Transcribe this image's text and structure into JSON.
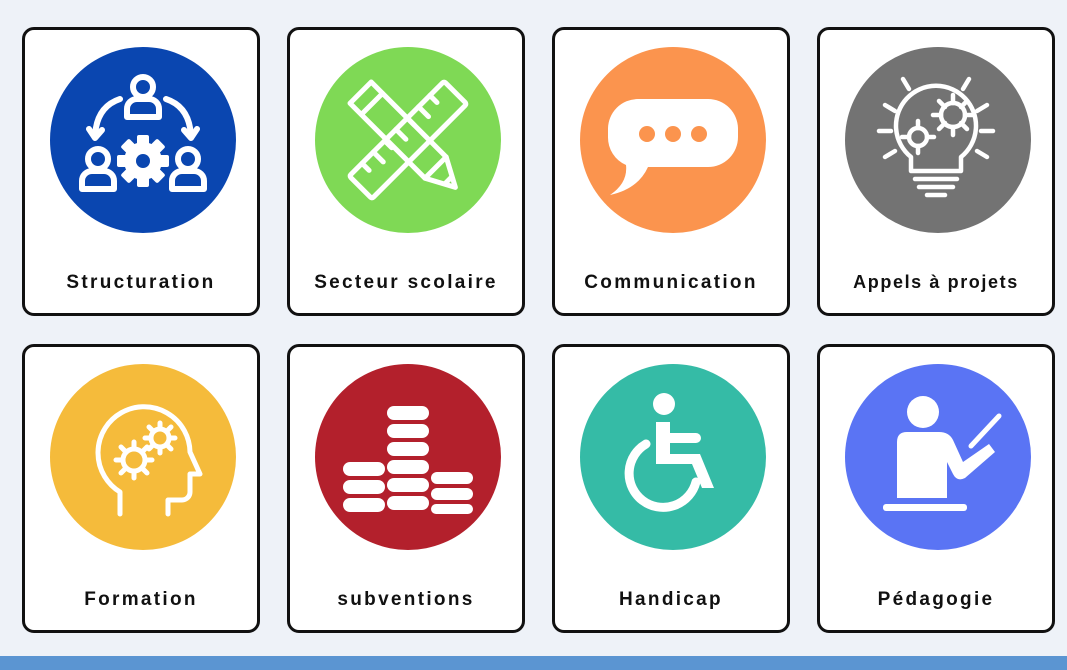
{
  "tiles": [
    {
      "label": "Structuration",
      "icon": "teamwork-cycle-icon",
      "color": "#0a46b0"
    },
    {
      "label": "Secteur scolaire",
      "icon": "pencil-ruler-icon",
      "color": "#7fd955"
    },
    {
      "label": "Communication",
      "icon": "speech-bubble-icon",
      "color": "#fb944e"
    },
    {
      "label": "Appels à projets",
      "icon": "lightbulb-gears-icon",
      "color": "#737373"
    },
    {
      "label": "Formation",
      "icon": "head-gears-icon",
      "color": "#f5bb3b"
    },
    {
      "label": "subventions",
      "icon": "coin-stacks-icon",
      "color": "#b3202c"
    },
    {
      "label": "Handicap",
      "icon": "wheelchair-icon",
      "color": "#35bba6"
    },
    {
      "label": "Pédagogie",
      "icon": "teacher-icon",
      "color": "#5a74f4"
    }
  ]
}
